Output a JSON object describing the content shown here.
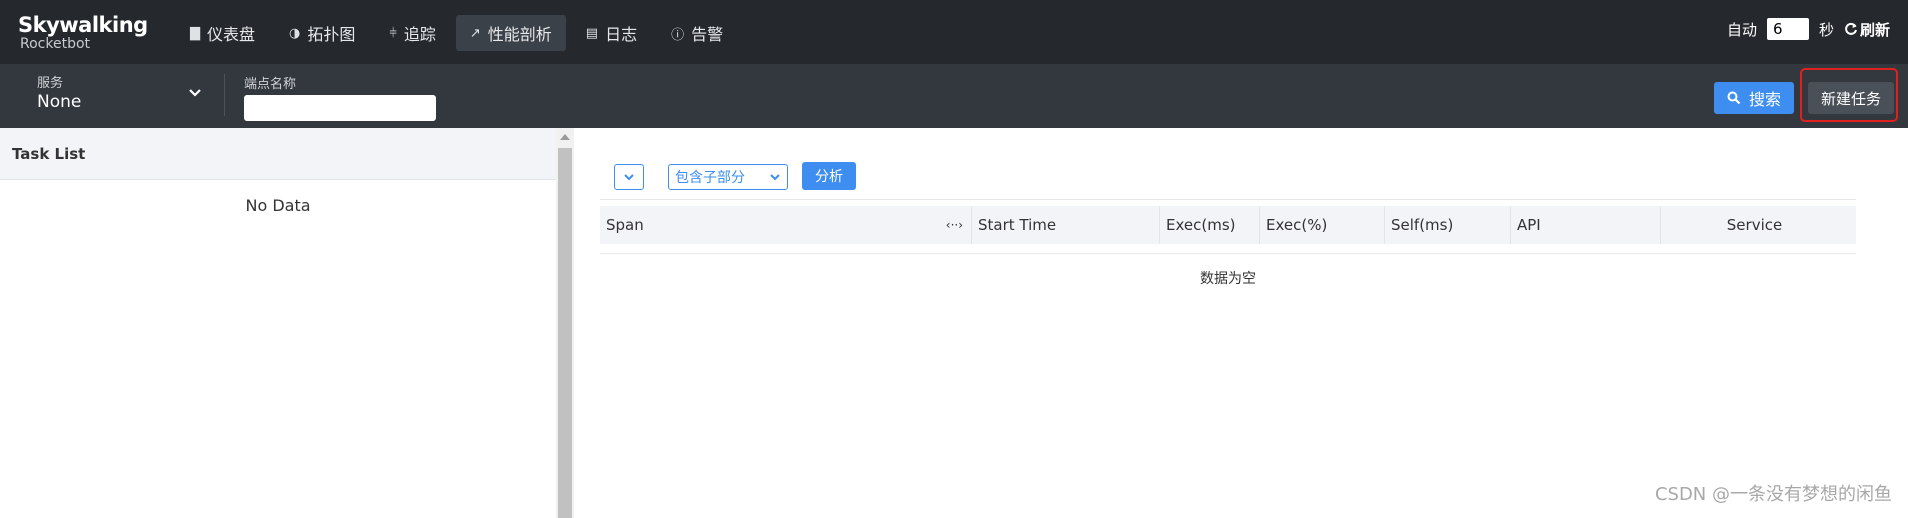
{
  "logo": {
    "line1": "Skywalking",
    "line2": "Rocketbot"
  },
  "nav": [
    {
      "icon": "bar-chart-icon",
      "glyph": "▇",
      "label": "仪表盘",
      "active": false
    },
    {
      "icon": "topology-icon",
      "glyph": "◑",
      "label": "拓扑图",
      "active": false
    },
    {
      "icon": "trace-icon",
      "glyph": "⫩",
      "label": "追踪",
      "active": false
    },
    {
      "icon": "profile-line-icon",
      "glyph": "↗",
      "label": "性能剖析",
      "active": true
    },
    {
      "icon": "log-icon",
      "glyph": "▤",
      "label": "日志",
      "active": false
    },
    {
      "icon": "alarm-icon",
      "glyph": "ⓘ",
      "label": "告警",
      "active": false
    }
  ],
  "auto_refresh": {
    "label": "自动",
    "interval": "6",
    "unit": "秒",
    "refresh_label": "刷新"
  },
  "toolbar": {
    "service_label": "服务",
    "service_value": "None",
    "endpoint_label": "端点名称",
    "endpoint_value": "",
    "search_label": "搜索",
    "new_task_label": "新建任务"
  },
  "task_list": {
    "title": "Task List",
    "empty": "No Data"
  },
  "analysis": {
    "mode_value": "包含子部分",
    "analyze_label": "分析"
  },
  "table": {
    "columns": [
      "Span",
      "Start Time",
      "Exec(ms)",
      "Exec(%)",
      "Self(ms)",
      "API",
      "Service"
    ],
    "empty": "数据为空"
  },
  "watermark": "CSDN @一条没有梦想的闲鱼",
  "colors": {
    "topbar": "#25292e",
    "toolbar": "#33383e",
    "primary": "#3d8ef0",
    "highlight": "#e0201f"
  }
}
